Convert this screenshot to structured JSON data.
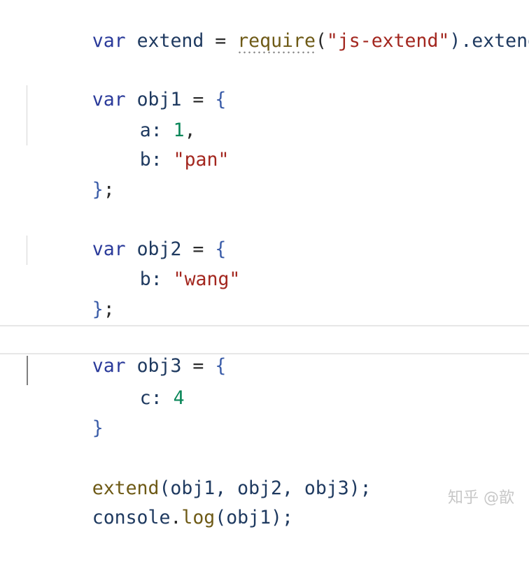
{
  "code": {
    "l1": {
      "kw": "var",
      "name": "extend",
      "op": "=",
      "fn": "require",
      "open": "(",
      "str": "\"js-extend\"",
      "close": ").extend"
    },
    "l3": {
      "kw": "var",
      "name": "obj1",
      "op": "=",
      "brace": "{"
    },
    "l4": {
      "key": "a:",
      "num": "1",
      "comma": ","
    },
    "l5": {
      "key": "b:",
      "str": "\"pan\""
    },
    "l6": {
      "brace": "}",
      "semi": ";"
    },
    "l8": {
      "kw": "var",
      "name": "obj2",
      "op": "=",
      "brace": "{"
    },
    "l9": {
      "key": "b:",
      "str": "\"wang\""
    },
    "l10": {
      "brace": "}",
      "semi": ";"
    },
    "l12": {
      "kw": "var",
      "name": "obj3",
      "op": "=",
      "brace": "{"
    },
    "l13": {
      "key": "c:",
      "num": "4"
    },
    "l14": {
      "brace": "}"
    },
    "l16": {
      "fn": "extend",
      "args": "(obj1, obj2, obj3);"
    },
    "l17": {
      "obj": "console",
      "dot": ".",
      "fn": "log",
      "args": "(obj1);"
    }
  },
  "watermark": "知乎 @歆"
}
